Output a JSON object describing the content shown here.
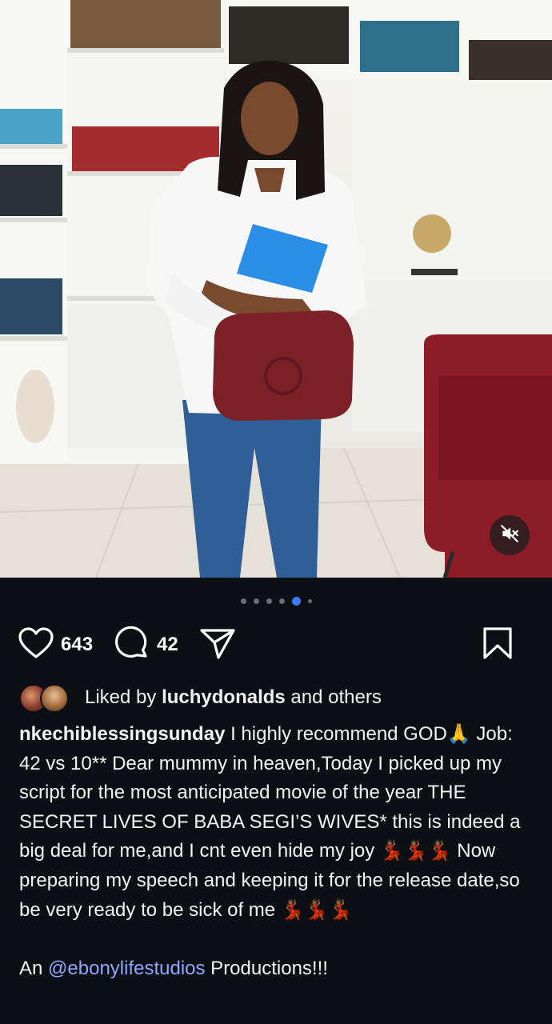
{
  "post": {
    "mute_icon": "speaker-muted-icon",
    "pager": {
      "total": 6,
      "active_index": 4
    },
    "actions": {
      "like_icon": "heart-icon",
      "like_count": "643",
      "comment_icon": "comment-bubble-icon",
      "comment_count": "42",
      "share_icon": "send-icon",
      "save_icon": "bookmark-icon"
    },
    "liked_by": {
      "prefix": "Liked by",
      "user": "luchydonalds",
      "suffix": "and others"
    },
    "caption": {
      "username": "nkechiblessingsunday",
      "text": " I highly recommend GOD🙏 Job: 42 vs 10** Dear mummy in heaven,Today I picked up my script for the most anticipated movie of the year THE SECRET LIVES  OF BABA SEGI’S WIVES* this is indeed a big deal for me,and I cnt even hide my joy 💃🏾💃🏾💃🏾 Now preparing my speech and keeping it for the release date,so be very ready to be sick of me 💃🏾💃🏾💃🏾",
      "tail_prefix": "An ",
      "mention": "@ebonylifestudios",
      "tail_suffix": " Productions!!!"
    },
    "colors": {
      "background": "#0c0f14",
      "accent_blue": "#3d7bfd",
      "mention": "#8fa7ff"
    }
  }
}
